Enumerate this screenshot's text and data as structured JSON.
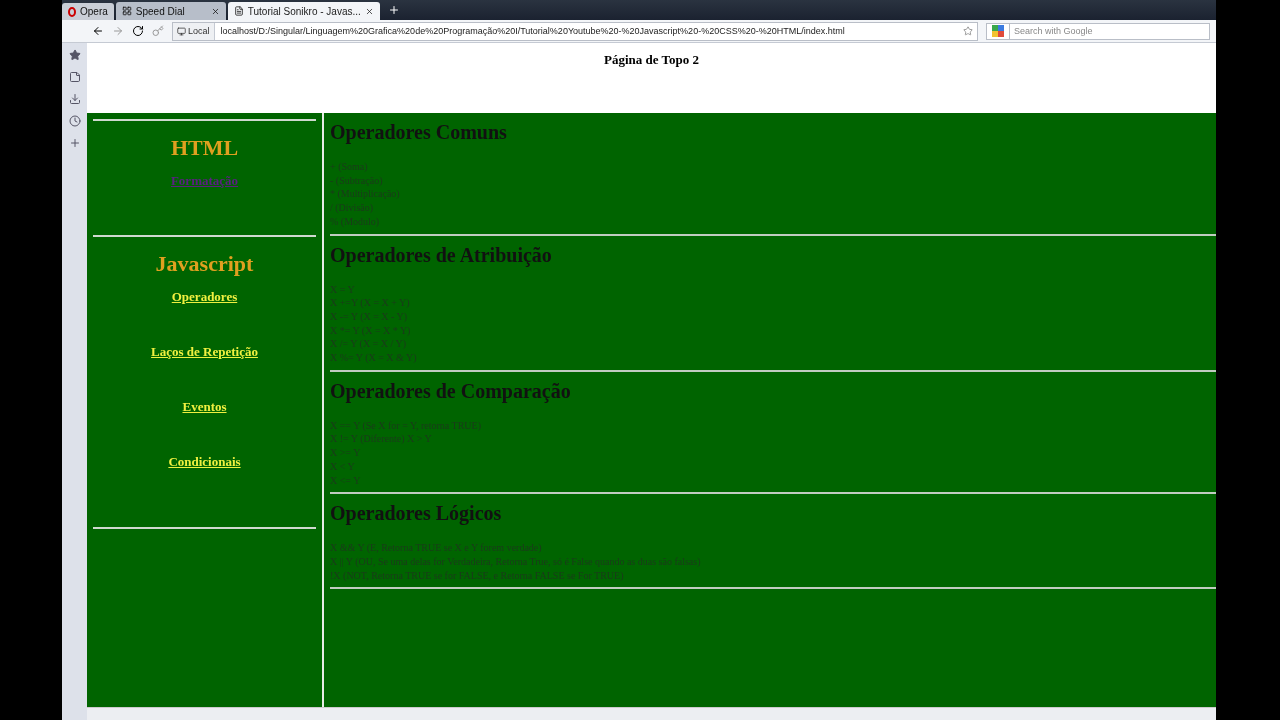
{
  "browser": {
    "tabs": [
      {
        "label": "Opera",
        "kind": "menu",
        "selected": false
      },
      {
        "label": "Speed Dial",
        "kind": "tab",
        "selected": false
      },
      {
        "label": "Tutorial Sonikro - Javas...",
        "kind": "tab",
        "selected": true
      }
    ],
    "address_badge": "Local",
    "address": "localhost/D:/Singular/Linguagem%20Grafica%20de%20Programação%20I/Tutorial%20Youtube%20-%20Javascript%20-%20CSS%20-%20HTML/index.html",
    "search": {
      "placeholder": "Search with Google"
    }
  },
  "page": {
    "header": "Página de Topo 2",
    "nav": [
      {
        "title": "HTML",
        "links": [
          {
            "label": "Formatação",
            "visited": true
          }
        ]
      },
      {
        "title": "Javascript",
        "links": [
          {
            "label": "Operadores",
            "visited": false
          },
          {
            "label": "Laços de Repetição",
            "visited": false
          },
          {
            "label": "Eventos",
            "visited": false
          },
          {
            "label": "Condicionais",
            "visited": false
          }
        ]
      }
    ],
    "sections": [
      {
        "title": "Operadores Comuns",
        "lines": [
          "+ (Soma)",
          "- (Subtração)",
          "* (Multiplicação)",
          "/ (Divisão)",
          "% (Modulo)"
        ]
      },
      {
        "title": "Operadores de Atribuição",
        "lines": [
          "X = Y",
          "X +=Y (X = X + Y)",
          "X -= Y (X = X - Y)",
          "X *= Y (X = X * Y)",
          "X /= Y (X = X / Y)",
          "X %= Y (X = X & Y)"
        ]
      },
      {
        "title": "Operadores de Comparação",
        "lines": [
          "X == Y (Se X for = Y, retorna TRUE)",
          "X != Y (Diferente) X > Y",
          "X >= Y",
          "X < Y",
          "X <= Y"
        ]
      },
      {
        "title": "Operadores Lógicos",
        "lines": [
          "X && Y (E, Retorna TRUE se X e Y forem verdade)",
          "X || Y (OU, Se uma delas for Verdadeira, Retorna True, só é False quando as duas são falsas)",
          "!X (NOT, Retorna TRUE se for FALSE, e Retorna FALSE se For TRUE)"
        ]
      }
    ]
  }
}
